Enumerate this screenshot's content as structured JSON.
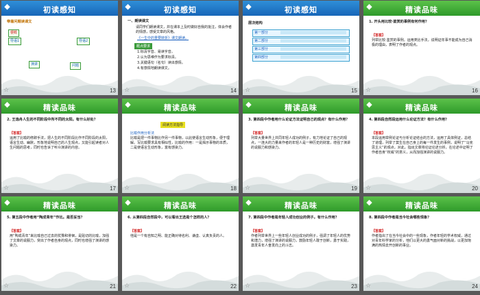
{
  "slides": [
    {
      "num": "13",
      "title": "初读感知",
      "header": "blue",
      "body": "带着问题读课文",
      "extra": [
        "梗概",
        "导语1",
        "导语2",
        "演讲",
        "问题"
      ]
    },
    {
      "num": "14",
      "title": "初读感知",
      "header": "blue",
      "body": "一、朗读课文",
      "extra": [
        "请同学们朗读课文，并在课本上及时做好自我的批注，体会作者的情感，感受文章的风格。",
        "《一生中的重要转折》课文朗读。",
        "概点要求",
        "1.标清字音、易读字音。",
        "2.认为思维作为要求标清。",
        "3.关键语句（名句）读出感情。",
        "4.有感情地朗读课文。"
      ]
    },
    {
      "num": "15",
      "title": "初读感知",
      "header": "blue",
      "body": "层次结构",
      "extra": [
        "第一部分",
        "第二部分",
        "第三部分",
        "第四部分"
      ]
    },
    {
      "num": "16",
      "title": "精读品味",
      "header": "green",
      "body": "1. 开头用比较·鉴赏的事例有何作用？",
      "extra": [
        "【答案】",
        "列举比较·鉴赏的事例。运用类比手法，说明证年事不能成为自己消极的理由，表明了作者的观点。"
      ]
    },
    {
      "num": "17",
      "title": "精读品味",
      "header": "green",
      "body": "2. 王逸舟人生的不同阶段中所不同的太阳。有什么好处？",
      "extra": [
        "【答案】",
        "运用了比喻的修辞手法，把人生的不同阶段比作不同阶段的太阳，语言生动、幽默，形象地说明自己的人生观点，又能引起读者对人生问题的思考，同时也告诉了听众演讲的内容。"
      ]
    },
    {
      "num": "18",
      "title": "精读品味",
      "header": "green",
      "body": "阅读方法指导",
      "extra": [
        "比喻作用分析法",
        "比喻是把一件事物比作另一件事物，以此使语言生动形象，便于理解。写比喻要求具有相似性，比喻的作用：一是揭示事物的本质，二是使语言生动形象，富有感染力。"
      ]
    },
    {
      "num": "19",
      "title": "精读品味",
      "header": "green",
      "body": "3. 第四段中作者用什么论证方法证明自己的观点？有什么作用？",
      "extra": [
        "【答案】",
        "列举大量世界上共同年轻人成功的例子，有力地论证了自己的观点，一连大的力量来作者的年轻人是一种历史的财富，增强了演讲的说服力和感染力。"
      ]
    },
    {
      "num": "20",
      "title": "精读品味",
      "header": "green",
      "body": "4. 第四段自然段运用什么论证方法？有什么作用？",
      "extra": [
        "【答案】",
        "本段运用举例论证与分析论证结合的方法，运用了具体例证，总结了道理，列举了莫生在自己身上的每一件发生的事例，说明了“马克思主义”的观点，对此，指出文章将论证论述分析，在论述中证明了作者自身“权威”的意义，从而加强演讲的说服力。"
      ]
    },
    {
      "num": "21",
      "title": "精读品味",
      "header": "green",
      "body": "5. 第五段中作者用“陶成青年”作比。是否妥当？",
      "extra": [
        "【答案】",
        "用“陶成青年”来比喻自己过去的犹豫和徘徊，是贴切的比喻，加强了文章的说服力，突出了作者自身的观点，同时也增强了演讲的感染力。"
      ]
    },
    {
      "num": "22",
      "title": "精读品味",
      "header": "green",
      "body": "6. 从第四段自然段中，可以看出王选是个怎样的人？",
      "extra": [
        "【答案】",
        "他是一个有自知之明、能正确对待名利、谦虚、认真负责的人。"
      ]
    },
    {
      "num": "23",
      "title": "精读品味",
      "header": "green",
      "body": "7. 第四段中作者是年轻人成功创业的例子。有什么作用？",
      "extra": [
        "【答案】",
        "作者列举世界上一些年轻人创业成功的例子，强调了年轻人的优势和潜力，增强了演讲的说服力，鼓励年轻人敢于创新，勇于实践，激发青年人奋发向上的斗志。"
      ]
    },
    {
      "num": "24",
      "title": "精读品味",
      "header": "green",
      "body": "8. 第四段中作者是当今社会哪些现象？",
      "extra": [
        "【答案】",
        "作者指出了在当今社会中的一些现象，作者年轻的学术权威，通过对青年科学家的分析，他们以更大的勇气面对新的挑战，以更加饱满的热情去开创新的事业。"
      ]
    }
  ],
  "colors": {
    "blue": "#1f78c8",
    "green": "#3aa63a",
    "answer": "#d01818",
    "bg": "#585858"
  },
  "footer_star": "☆"
}
